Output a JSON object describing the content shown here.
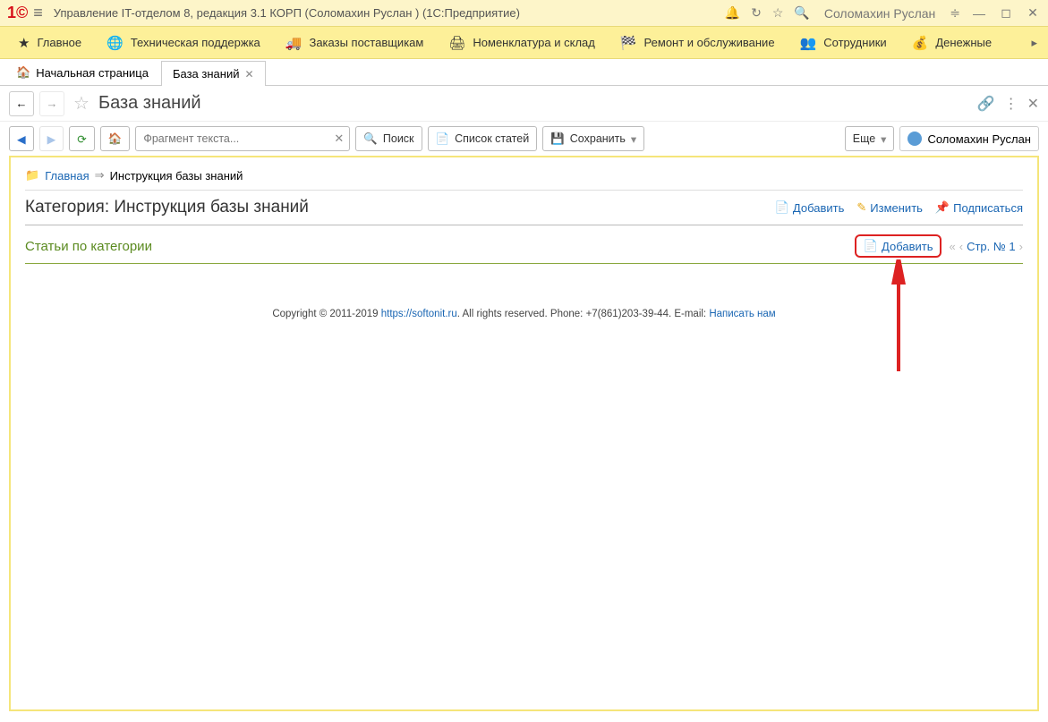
{
  "titlebar": {
    "title": "Управление IT-отделом 8, редакция 3.1 КОРП (Соломахин Руслан )  (1С:Предприятие)",
    "user": "Соломахин Руслан"
  },
  "nav": {
    "items": [
      {
        "label": "Главное",
        "icon": "★"
      },
      {
        "label": "Техническая поддержка",
        "icon": "🌐"
      },
      {
        "label": "Заказы поставщикам",
        "icon": "🚚"
      },
      {
        "label": "Номенклатура и склад",
        "icon": "🖨"
      },
      {
        "label": "Ремонт и обслуживание",
        "icon": "🏁"
      },
      {
        "label": "Сотрудники",
        "icon": "👥"
      },
      {
        "label": "Денежные",
        "icon": "💰"
      }
    ]
  },
  "tabs": {
    "home": "Начальная страница",
    "active": "База знаний"
  },
  "header": {
    "title": "База знаний"
  },
  "toolbar": {
    "search_placeholder": "Фрагмент текста...",
    "search": "Поиск",
    "list": "Список статей",
    "save": "Сохранить",
    "more": "Еще",
    "user": "Соломахин Руслан"
  },
  "breadcrumb": {
    "home": "Главная",
    "current": "Инструкция базы знаний"
  },
  "category": {
    "prefix": "Категория: ",
    "name": "Инструкция базы знаний",
    "add": "Добавить",
    "edit": "Изменить",
    "subscribe": "Подписаться"
  },
  "articles": {
    "title": "Статьи по категории",
    "add": "Добавить",
    "page_label": "Стр. № 1"
  },
  "footer": {
    "copyright": "Copyright © 2011-2019 ",
    "site": "https://softonit.ru",
    "rights": ". All rights reserved. Phone: +7(861)203-39-44. E-mail: ",
    "email": "Написать нам"
  }
}
